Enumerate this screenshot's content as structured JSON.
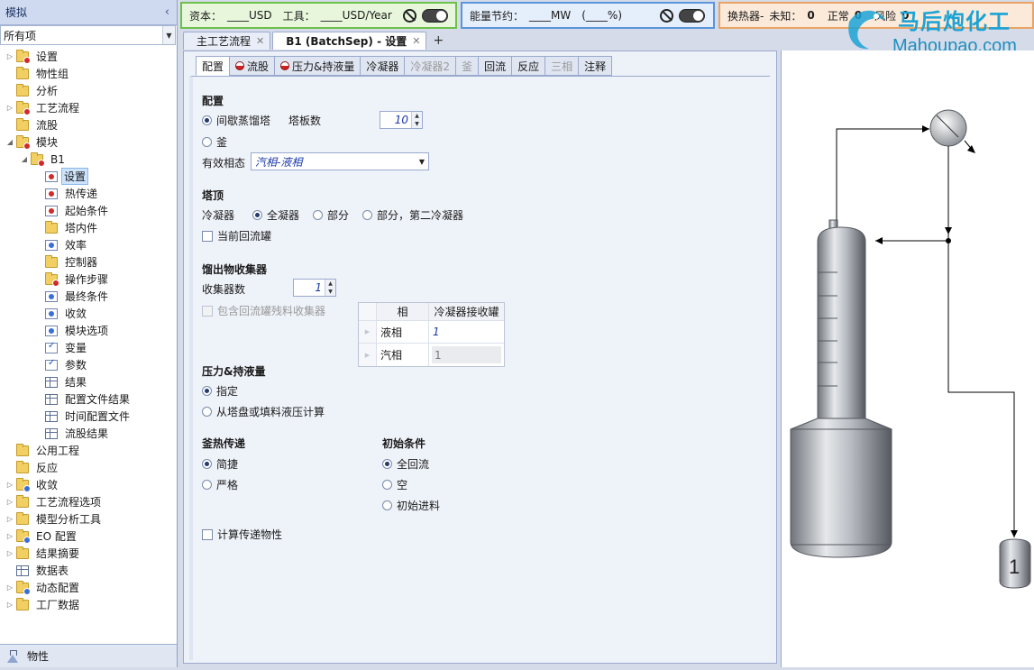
{
  "nav": {
    "title": "模拟",
    "collapse_glyph": "‹",
    "filter_value": "所有项",
    "footer_label": "物性",
    "tree": [
      {
        "label": "设置",
        "level": 0,
        "arrow": "▷",
        "icon": "folder-red"
      },
      {
        "label": "物性组",
        "level": 0,
        "arrow": "",
        "icon": "folder"
      },
      {
        "label": "分析",
        "level": 0,
        "arrow": "",
        "icon": "folder"
      },
      {
        "label": "工艺流程",
        "level": 0,
        "arrow": "▷",
        "icon": "folder-red"
      },
      {
        "label": "流股",
        "level": 0,
        "arrow": "",
        "icon": "folder"
      },
      {
        "label": "模块",
        "level": 0,
        "arrow": "◢",
        "icon": "folder-red"
      },
      {
        "label": "B1",
        "level": 1,
        "arrow": "◢",
        "icon": "folder-red"
      },
      {
        "label": "设置",
        "level": 2,
        "arrow": "",
        "icon": "form-red",
        "selected": true
      },
      {
        "label": "热传递",
        "level": 2,
        "arrow": "",
        "icon": "form-red"
      },
      {
        "label": "起始条件",
        "level": 2,
        "arrow": "",
        "icon": "form-red"
      },
      {
        "label": "塔内件",
        "level": 2,
        "arrow": "",
        "icon": "folder"
      },
      {
        "label": "效率",
        "level": 2,
        "arrow": "",
        "icon": "form-blue"
      },
      {
        "label": "控制器",
        "level": 2,
        "arrow": "",
        "icon": "folder"
      },
      {
        "label": "操作步骤",
        "level": 2,
        "arrow": "",
        "icon": "folder-red"
      },
      {
        "label": "最终条件",
        "level": 2,
        "arrow": "",
        "icon": "form-blue"
      },
      {
        "label": "收敛",
        "level": 2,
        "arrow": "",
        "icon": "form-blue"
      },
      {
        "label": "模块选项",
        "level": 2,
        "arrow": "",
        "icon": "form-blue"
      },
      {
        "label": "变量",
        "level": 2,
        "arrow": "",
        "icon": "form-check"
      },
      {
        "label": "参数",
        "level": 2,
        "arrow": "",
        "icon": "form-check"
      },
      {
        "label": "结果",
        "level": 2,
        "arrow": "",
        "icon": "table"
      },
      {
        "label": "配置文件结果",
        "level": 2,
        "arrow": "",
        "icon": "table"
      },
      {
        "label": "时间配置文件",
        "level": 2,
        "arrow": "",
        "icon": "table"
      },
      {
        "label": "流股结果",
        "level": 2,
        "arrow": "",
        "icon": "table"
      },
      {
        "label": "公用工程",
        "level": 0,
        "arrow": "",
        "icon": "folder"
      },
      {
        "label": "反应",
        "level": 0,
        "arrow": "",
        "icon": "folder"
      },
      {
        "label": "收敛",
        "level": 0,
        "arrow": "▷",
        "icon": "folder-blue"
      },
      {
        "label": "工艺流程选项",
        "level": 0,
        "arrow": "▷",
        "icon": "folder"
      },
      {
        "label": "模型分析工具",
        "level": 0,
        "arrow": "▷",
        "icon": "folder"
      },
      {
        "label": "EO 配置",
        "level": 0,
        "arrow": "▷",
        "icon": "folder-blue"
      },
      {
        "label": "结果摘要",
        "level": 0,
        "arrow": "▷",
        "icon": "folder"
      },
      {
        "label": "数据表",
        "level": 0,
        "arrow": "",
        "icon": "table"
      },
      {
        "label": "动态配置",
        "level": 0,
        "arrow": "▷",
        "icon": "folder-blue"
      },
      {
        "label": "工厂数据",
        "level": 0,
        "arrow": "▷",
        "icon": "folder"
      }
    ]
  },
  "topbar": {
    "cost_label": "资本：",
    "cost_value": "____USD",
    "utility_label": "工具：",
    "utility_value": "____USD/Year",
    "energy_label": "能量节约：",
    "energy_value": "____MW",
    "energy_pct": "(____%)",
    "hx_label": "换热器-",
    "unknown_label": "未知：",
    "unknown_value": "0",
    "normal_label": "正常",
    "normal_value": "0",
    "risk_label": "风险",
    "risk_value": "0"
  },
  "logo": {
    "cn": "马后炮化工",
    "en": "Mahoupao.com"
  },
  "doc_tabs": [
    {
      "label": "主工艺流程",
      "active": false
    },
    {
      "label": "B1 (BatchSep) - 设置",
      "active": true
    }
  ],
  "doc_tab_close": "✕",
  "doc_tab_add": "+",
  "form_tabs": [
    {
      "label": "配置",
      "active": true,
      "disabled": false,
      "status": ""
    },
    {
      "label": "流股",
      "active": false,
      "disabled": false,
      "status": "incomplete"
    },
    {
      "label": "压力&持液量",
      "active": false,
      "disabled": false,
      "status": "incomplete"
    },
    {
      "label": "冷凝器",
      "active": false,
      "disabled": false,
      "status": ""
    },
    {
      "label": "冷凝器2",
      "active": false,
      "disabled": true,
      "status": ""
    },
    {
      "label": "釜",
      "active": false,
      "disabled": true,
      "status": ""
    },
    {
      "label": "回流",
      "active": false,
      "disabled": false,
      "status": ""
    },
    {
      "label": "反应",
      "active": false,
      "disabled": false,
      "status": ""
    },
    {
      "label": "三相",
      "active": false,
      "disabled": true,
      "status": ""
    },
    {
      "label": "注释",
      "active": false,
      "disabled": false,
      "status": ""
    }
  ],
  "config": {
    "section": "配置",
    "batch_column": "间歇蒸馏塔",
    "stages_label": "塔板数",
    "stages_value": "10",
    "pot": "釜",
    "valid_phases_label": "有效相态",
    "valid_phases_value": "汽相-液相"
  },
  "overhead": {
    "section": "塔顶",
    "condenser_label": "冷凝器",
    "opt_total": "全凝器",
    "opt_partial": "部分",
    "opt_partial2": "部分，第二冷凝器",
    "reflux_drum": "当前回流罐"
  },
  "distillate": {
    "section": "馏出物收集器",
    "count_label": "收集器数",
    "count_value": "1",
    "include_residual": "包含回流罐残料收集器",
    "grid_headers": [
      "相",
      "冷凝器接收罐"
    ],
    "grid_rows": [
      {
        "phase": "液相",
        "value": "1"
      },
      {
        "phase": "汽相",
        "value": "1"
      }
    ]
  },
  "pressure": {
    "section": "压力&持液量",
    "opt_specify": "指定",
    "opt_calc": "从塔盘或填料液压计算"
  },
  "pot_heat": {
    "section": "釜热传递",
    "opt_simple": "简捷",
    "opt_rigorous": "严格"
  },
  "initial": {
    "section": "初始条件",
    "opt_total_reflux": "全回流",
    "opt_empty": "空",
    "opt_initial_charge": "初始进料"
  },
  "calc_transport": "计算传递物性",
  "flowsheet": {
    "receiver_label": "1"
  },
  "colors": {
    "cost_border": "#6cc04a",
    "energy_border": "#5b95dc",
    "hx_border": "#e9a464",
    "incomplete_red": "#d41f1f",
    "value_blue": "#1a38a8"
  }
}
